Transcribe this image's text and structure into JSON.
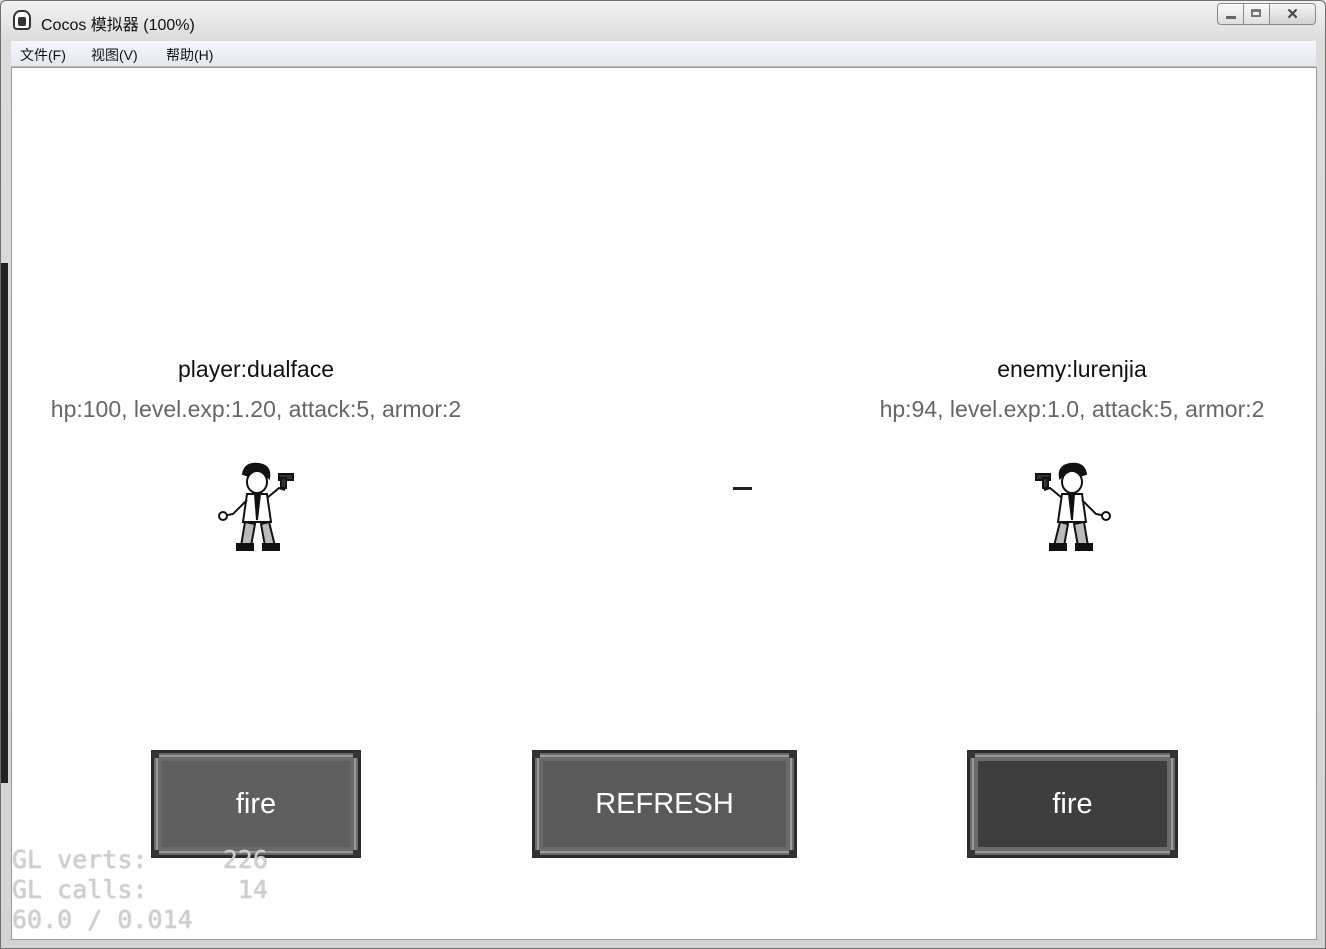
{
  "window": {
    "title": "Cocos 模拟器 (100%)"
  },
  "menu": [
    "文件(F)",
    "视图(V)",
    "帮助(H)"
  ],
  "player": {
    "name": "player:dualface",
    "stats": "hp:100, level.exp:1.20, attack:5, armor:2"
  },
  "enemy": {
    "name": "enemy:lurenjia",
    "stats": "hp:94, level.exp:1.0, attack:5, armor:2"
  },
  "buttons": {
    "player_fire": "fire",
    "refresh": "REFRESH",
    "enemy_fire": "fire"
  },
  "colors": {
    "player_fire_bg": "#5f5f5f",
    "refresh_bg": "#5a5a5a",
    "enemy_fire_bg": "#3e3e3e"
  },
  "debug": {
    "verts": "GL verts:     226",
    "calls": "GL calls:      14",
    "fps": "60.0 / 0.014"
  }
}
